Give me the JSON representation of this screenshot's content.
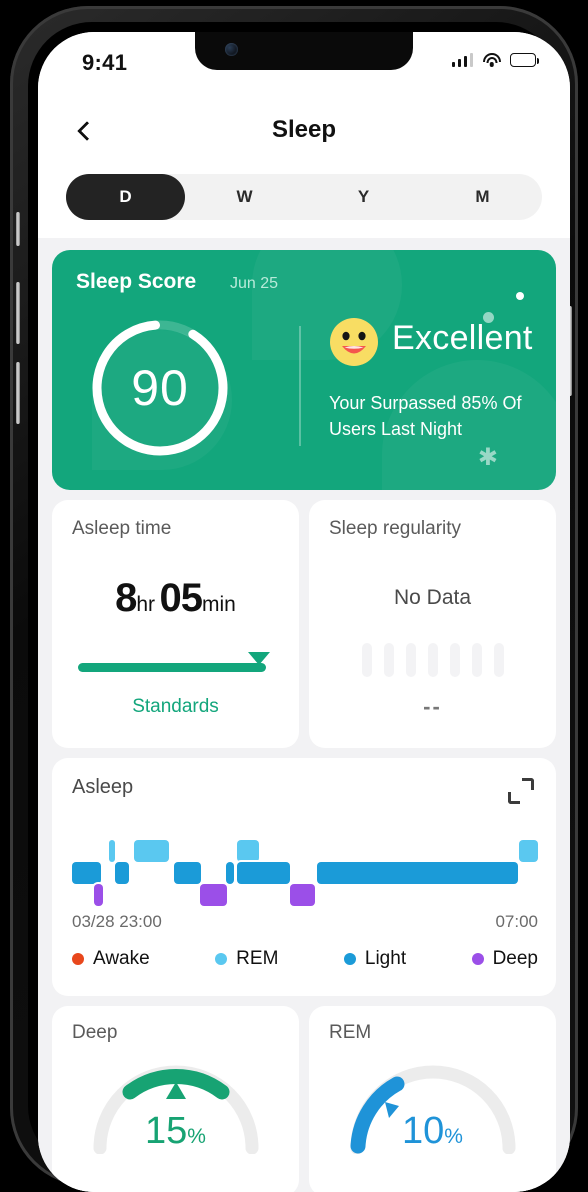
{
  "status_bar": {
    "time": "9:41",
    "signal_icon": "cellular-signal-icon",
    "wifi_icon": "wifi-icon",
    "battery_icon": "battery-full-icon"
  },
  "nav": {
    "back_icon": "chevron-left-icon",
    "title": "Sleep"
  },
  "segmented_control": {
    "options": [
      {
        "label": "D",
        "selected": true
      },
      {
        "label": "W",
        "selected": false
      },
      {
        "label": "Y",
        "selected": false
      },
      {
        "label": "M",
        "selected": false
      }
    ]
  },
  "sleep_score": {
    "title": "Sleep Score",
    "date": "Jun 25",
    "score": "90",
    "score_value": 90,
    "mood": "Excellent",
    "mood_emoji": "smiling-face-emoji",
    "message": "Your  Surpassed 85% Of Users Last Night",
    "accent_color": "#13a67c"
  },
  "asleep_time": {
    "title": "Asleep time",
    "hours": "8",
    "hours_unit": "hr",
    "minutes": "05",
    "minutes_unit": "min",
    "rating": "Standards",
    "bar_color": "#13a67c",
    "marker_percent": 90
  },
  "sleep_regularity": {
    "title": "Sleep regularity",
    "state": "No Data",
    "value": "--",
    "placeholder_bars": 7
  },
  "hypnogram": {
    "title": "Asleep",
    "expand_icon": "expand-icon",
    "start_time": "03/28 23:00",
    "end_time": "07:00",
    "legend": [
      {
        "label": "Awake",
        "color": "#e8471c"
      },
      {
        "label": "REM",
        "color": "#5ac8f0"
      },
      {
        "label": "Light",
        "color": "#1b9bd8"
      },
      {
        "label": "Deep",
        "color": "#9b4fe8"
      }
    ],
    "stages": [
      {
        "stage": "Light",
        "start": 0.0,
        "end": 11.5,
        "color": "#1b9bd8",
        "level": 1
      },
      {
        "stage": "Deep",
        "start": 9.0,
        "end": 12.5,
        "color": "#9b4fe8",
        "level": 2
      },
      {
        "stage": "REM",
        "start": 15.0,
        "end": 17.5,
        "color": "#5ac8f0",
        "level": 0
      },
      {
        "stage": "Light",
        "start": 17.5,
        "end": 23.0,
        "color": "#1b9bd8",
        "level": 1
      },
      {
        "stage": "REM",
        "start": 25.0,
        "end": 39.0,
        "color": "#5ac8f0",
        "level": 0
      },
      {
        "stage": "Light",
        "start": 41.0,
        "end": 52.0,
        "color": "#1b9bd8",
        "level": 1
      },
      {
        "stage": "Deep",
        "start": 51.5,
        "end": 62.5,
        "color": "#9b4fe8",
        "level": 2
      },
      {
        "stage": "Light",
        "start": 62.0,
        "end": 65.5,
        "color": "#1b9bd8",
        "level": 1
      },
      {
        "stage": "REM",
        "start": 66.5,
        "end": 75.5,
        "color": "#5ac8f0",
        "level": 0
      },
      {
        "stage": "Light",
        "start": 66.5,
        "end": 88.0,
        "color": "#1b9bd8",
        "level": 1
      },
      {
        "stage": "Deep",
        "start": 88.0,
        "end": 98.0,
        "color": "#9b4fe8",
        "level": 2
      },
      {
        "stage": "Light",
        "start": 99.0,
        "end": 180.0,
        "color": "#1b9bd8",
        "level": 1
      },
      {
        "stage": "REM",
        "start": 180.5,
        "end": 188.0,
        "color": "#5ac8f0",
        "level": 0
      }
    ]
  },
  "deep_gauge": {
    "title": "Deep",
    "value": "15",
    "unit": "%",
    "value_number": 15,
    "color": "#17a373",
    "track_color": "#ececec",
    "marker_icon": "gauge-marker-triangle-icon"
  },
  "rem_gauge": {
    "title": "REM",
    "value": "10",
    "unit": "%",
    "value_number": 10,
    "color": "#1f93d8",
    "track_color": "#ececec",
    "marker_icon": "gauge-marker-triangle-icon"
  }
}
